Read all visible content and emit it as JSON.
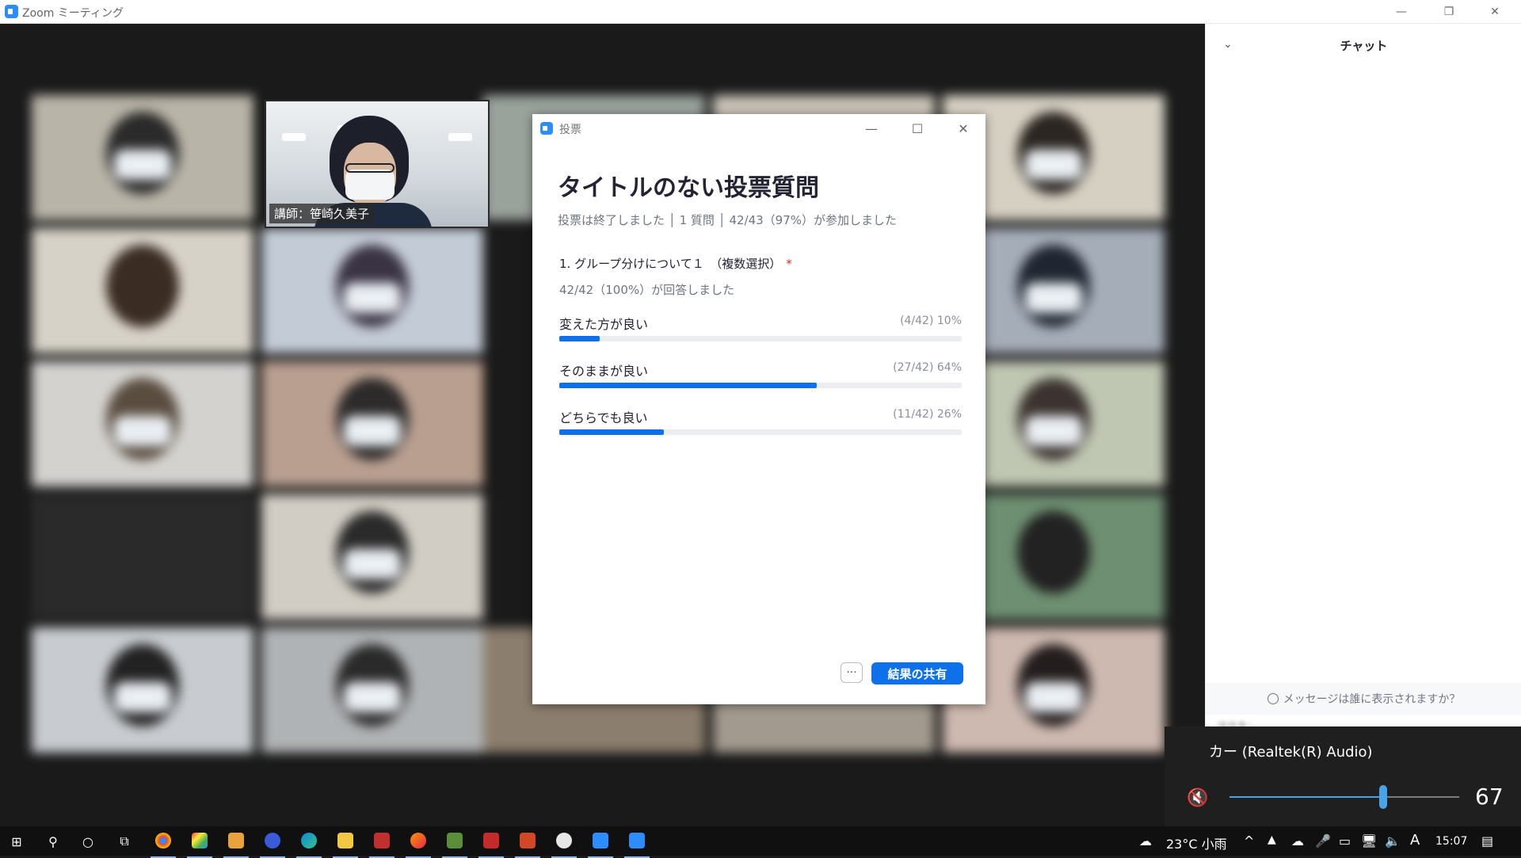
{
  "window": {
    "title": "Zoom ミーティング",
    "minimize_icon": "—",
    "restore_icon": "❐",
    "close_icon": "✕"
  },
  "presenter": {
    "name": "講師：笹崎久美子"
  },
  "poll": {
    "window_title": "投票",
    "minimize_icon": "—",
    "maximize_icon": "☐",
    "close_icon": "✕",
    "title": "タイトルのない投票質問",
    "status": "投票は終了しました │ 1 質問 │ 42/43（97%）が参加しました",
    "question": "1. グループ分けについて１　（複数選択）",
    "required_mark": "*",
    "answered": "42/42（100%）が回答しました",
    "options": [
      {
        "label": "変えた方が良い",
        "stat": "(4/42) 10%",
        "percent": 10
      },
      {
        "label": "そのままが良い",
        "stat": "(27/42) 64%",
        "percent": 64
      },
      {
        "label": "どちらでも良い",
        "stat": "(11/42) 26%",
        "percent": 26
      }
    ],
    "more_label": "···",
    "share_label": "結果の共有"
  },
  "chat": {
    "collapse_icon": "⌄",
    "title": "チャット",
    "who_can_see": "メッセージは誰に表示されますか？",
    "send_to": "送信先："
  },
  "volume": {
    "device": "カー (Realtek(R) Audio)",
    "mute_icon": "🔇",
    "value": "67",
    "level": 67
  },
  "taskbar": {
    "start_icon": "⊞",
    "search_icon": "⚲",
    "cortana_icon": "○",
    "taskview_icon": "⧉",
    "weather": "23°C 小雨",
    "chevron_icon": "^",
    "ime": "A",
    "clock": "15:07",
    "notification_icon": "▤"
  },
  "colors": {
    "accent": "#0e71eb",
    "zoom_blue": "#2d8cff"
  }
}
